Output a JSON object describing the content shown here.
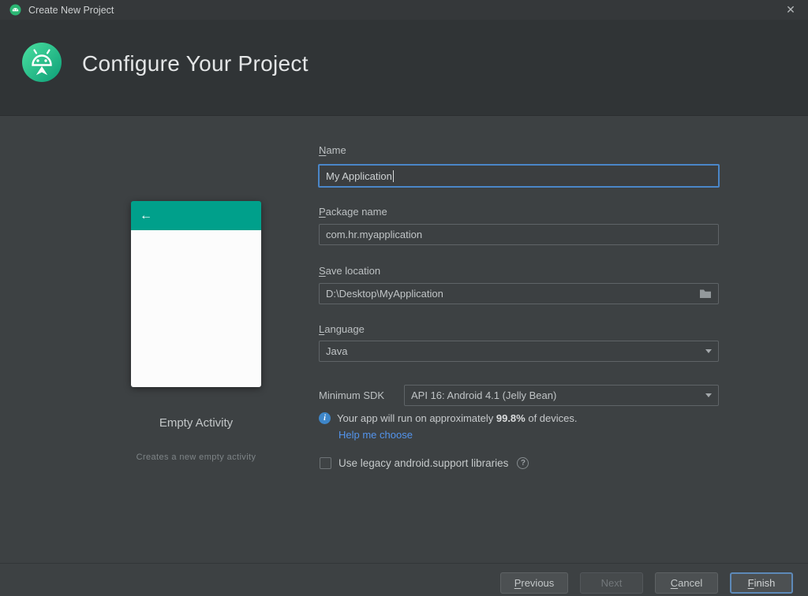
{
  "titlebar": {
    "title": "Create New Project"
  },
  "icons": {
    "close": "✕",
    "back_arrow": "←",
    "info": "i",
    "help": "?"
  },
  "header": {
    "title": "Configure Your Project"
  },
  "preview": {
    "name": "Empty Activity",
    "description": "Creates a new empty activity"
  },
  "form": {
    "name": {
      "label": "Name",
      "value": "My Application"
    },
    "package_name": {
      "label": "Package name",
      "value": "com.hr.myapplication"
    },
    "save_location": {
      "label": "Save location",
      "value": "D:\\Desktop\\MyApplication"
    },
    "language": {
      "label": "Language",
      "value": "Java"
    },
    "minimum_sdk": {
      "label": "Minimum SDK",
      "value": "API 16: Android 4.1 (Jelly Bean)"
    },
    "sdk_info": {
      "prefix": "Your app will run on approximately ",
      "percent": "99.8%",
      "suffix": " of devices."
    },
    "help_link": "Help me choose",
    "legacy_checkbox_label": "Use legacy android.support libraries"
  },
  "buttons": {
    "previous": "Previous",
    "next": "Next",
    "cancel": "Cancel",
    "finish": "Finish"
  },
  "colors": {
    "teal_accent": "#00A08B",
    "android_green": "#3ddc84",
    "link_blue": "#5394ec",
    "focus_blue": "#4a86c8",
    "background": "#3d4143"
  }
}
